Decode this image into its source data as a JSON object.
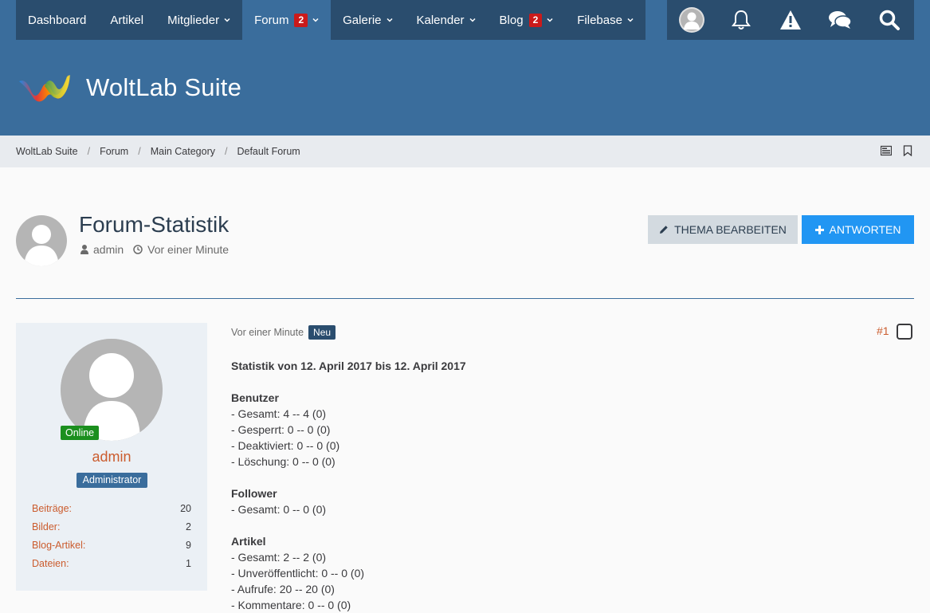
{
  "nav": {
    "items": [
      {
        "label": "Dashboard"
      },
      {
        "label": "Artikel"
      },
      {
        "label": "Mitglieder"
      },
      {
        "label": "Forum",
        "badge": "2"
      },
      {
        "label": "Galerie"
      },
      {
        "label": "Kalender"
      },
      {
        "label": "Blog",
        "badge": "2"
      },
      {
        "label": "Filebase"
      }
    ],
    "user_icons": [
      "avatar",
      "bell-icon",
      "warning-icon",
      "conversations-icon",
      "search-icon"
    ]
  },
  "header": {
    "logo_text": "WoltLab Suite"
  },
  "breadcrumb": [
    "WoltLab Suite",
    "Forum",
    "Main Category",
    "Default Forum"
  ],
  "thread": {
    "title": "Forum-Statistik",
    "author": "admin",
    "time": "Vor einer Minute",
    "edit_label": "THEMA BEARBEITEN",
    "reply_label": "ANTWORTEN"
  },
  "user": {
    "status": "Online",
    "name": "admin",
    "rank": "Administrator",
    "stats": [
      {
        "label": "Beiträge:",
        "value": "20"
      },
      {
        "label": "Bilder:",
        "value": "2"
      },
      {
        "label": "Blog-Artikel:",
        "value": "9"
      },
      {
        "label": "Dateien:",
        "value": "1"
      }
    ]
  },
  "post": {
    "time": "Vor einer Minute",
    "new_badge": "Neu",
    "number": "#1",
    "heading": "Statistik von 12. April 2017 bis 12. April 2017",
    "sections": [
      {
        "title": "Benutzer",
        "lines": [
          "- Gesamt: 4 -- 4 (0)",
          "- Gesperrt: 0 -- 0 (0)",
          "- Deaktiviert: 0 -- 0 (0)",
          "- Löschung: 0 -- 0 (0)"
        ]
      },
      {
        "title": "Follower",
        "lines": [
          "- Gesamt: 0 -- 0 (0)"
        ]
      },
      {
        "title": "Artikel",
        "lines": [
          "- Gesamt: 2 -- 2 (0)",
          "- Unveröffentlicht: 0 -- 0 (0)",
          "- Aufrufe: 20 -- 20 (0)",
          "- Kommentare: 0 -- 0 (0)"
        ]
      }
    ]
  },
  "colors": {
    "nav_dark": "#2a4d6e",
    "header_blue": "#3a6d9c",
    "accent_orange": "#cb5c2e",
    "button_blue": "#2196f3",
    "badge_red": "#cb1a1a",
    "online_green": "#1b8f1e"
  }
}
